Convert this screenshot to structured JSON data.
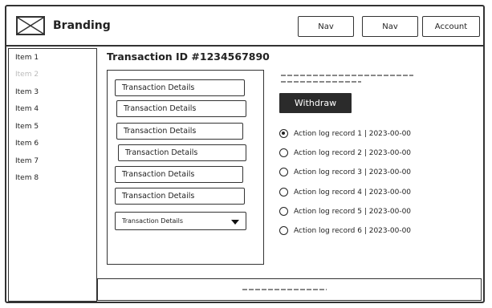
{
  "header": {
    "brand": "Branding",
    "nav": [
      "Nav",
      "Nav"
    ],
    "account": "Account"
  },
  "sidebar": {
    "items": [
      "Item 1",
      "Item 2",
      "Item 3",
      "Item 4",
      "Item 5",
      "Item 6",
      "Item 7",
      "Item 8"
    ]
  },
  "main": {
    "title": "Transaction ID #1234567890",
    "fields": [
      "Transaction Details",
      "Transaction Details",
      "Transaction Details",
      "Transaction Details",
      "Transaction Details",
      "Transaction Details"
    ],
    "select_value": "Transaction Details",
    "withdraw_label": "Withdraw",
    "actions": [
      "Action log record 1 | 2023-00-00",
      "Action log record 2 | 2023-00-00",
      "Action log record 3 | 2023-00-00",
      "Action log record 4 | 2023-00-00",
      "Action log record 5 | 2023-00-00",
      "Action log record 6 | 2023-00-00"
    ]
  }
}
